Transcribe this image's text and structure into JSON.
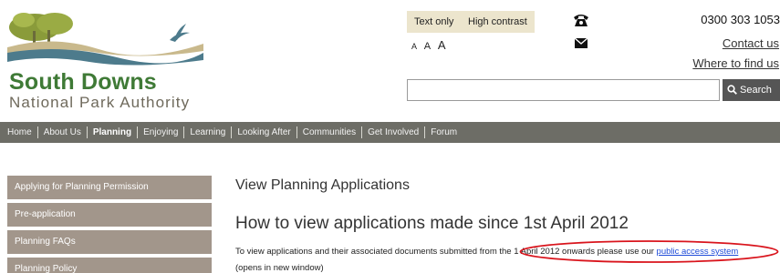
{
  "header": {
    "logo_title": "South Downs",
    "logo_subtitle": "National Park Authority",
    "accessibility": {
      "text_only": "Text only",
      "high_contrast": "High contrast"
    },
    "text_size": [
      "A",
      "A",
      "A"
    ],
    "phone": "0300 303 1053",
    "contact_link": "Contact us",
    "where_link": "Where to find us",
    "search": {
      "value": "",
      "button_label": "Search"
    }
  },
  "nav": {
    "items": [
      "Home",
      "About Us",
      "Planning",
      "Enjoying",
      "Learning",
      "Looking After",
      "Communities",
      "Get Involved",
      "Forum"
    ],
    "active": "Planning"
  },
  "sidebar": {
    "items": [
      "Applying for Planning Permission",
      "Pre-application",
      "Planning FAQs",
      "Planning Policy"
    ]
  },
  "main": {
    "page_title": "View Planning Applications",
    "section_title": "How to view applications made since 1st April 2012",
    "para_text": "To view applications and their associated documents submitted from the 1 April 2012 onwards please use our ",
    "para_link": "public access system",
    "para_line2": "(opens in new window)"
  },
  "colors": {
    "nav_bg": "#6d6d66",
    "sidebar_bg": "#a2968b",
    "logo_green": "#3f7a36",
    "link_blue": "#1e4bd8",
    "highlight_red": "#d9141c"
  },
  "icons": [
    "phone-icon",
    "mail-icon",
    "search-icon",
    "logo-landscape-icon"
  ]
}
